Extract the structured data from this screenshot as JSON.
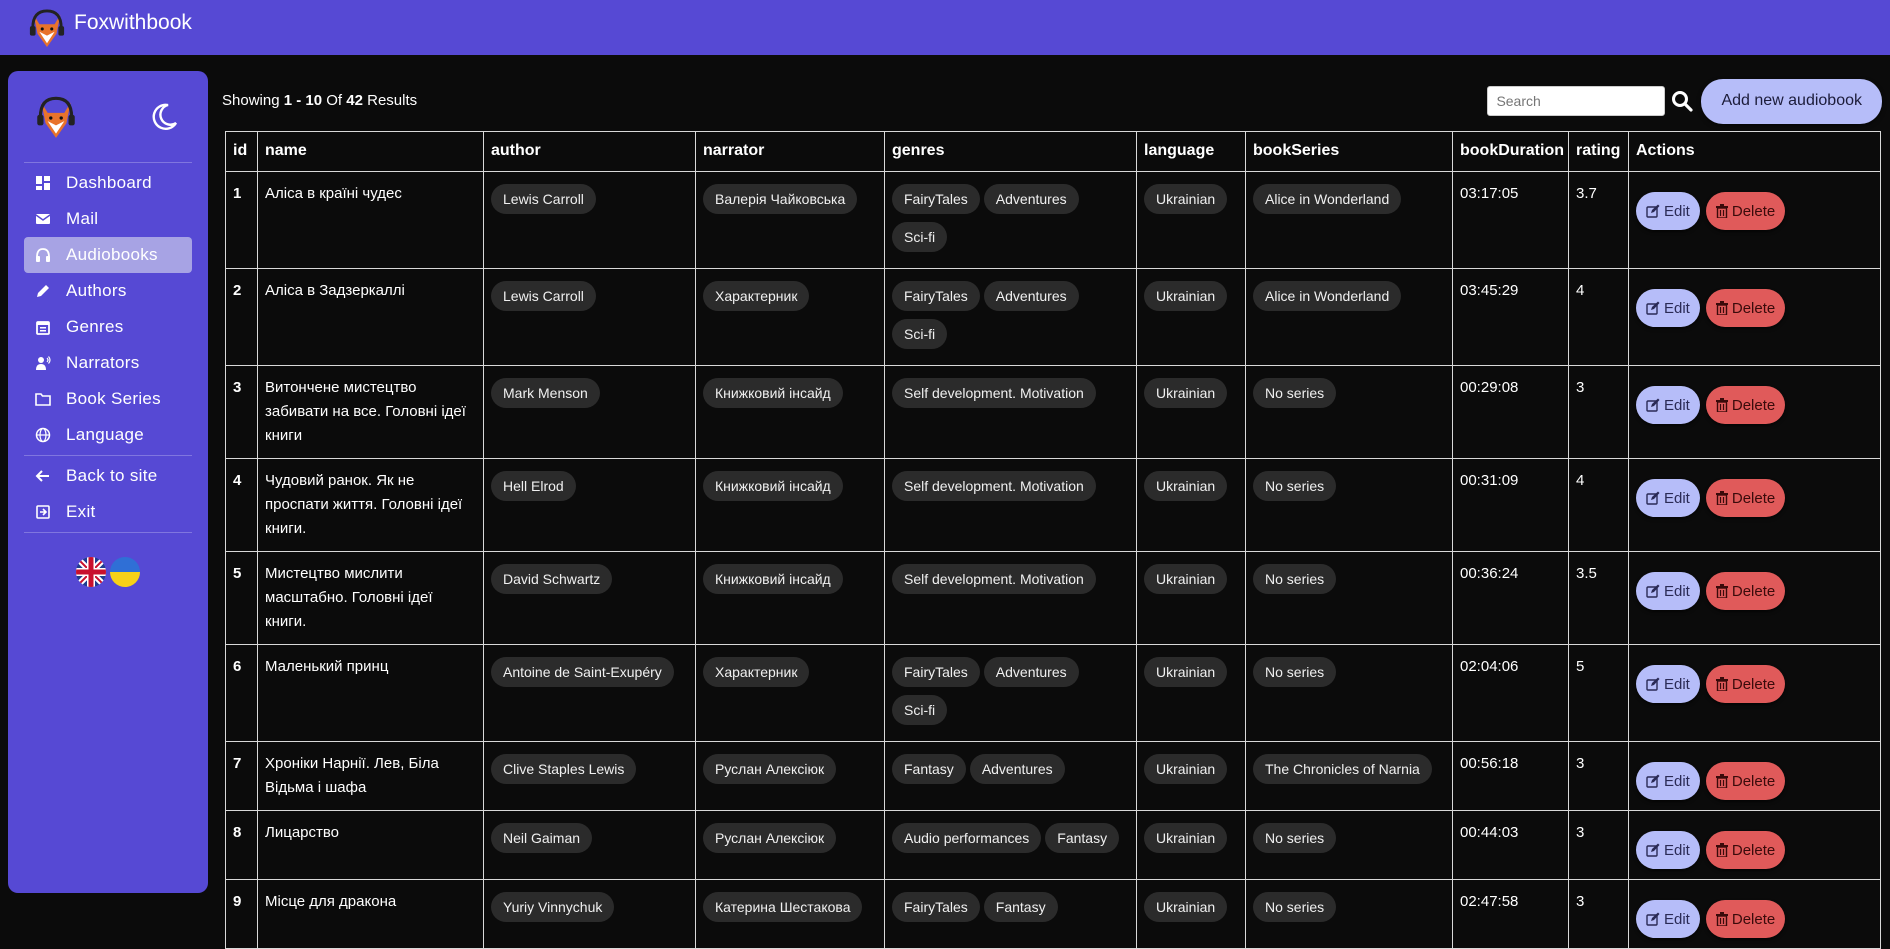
{
  "brand": "Foxwithbook",
  "sidebar": {
    "items": [
      {
        "label": "Dashboard",
        "icon": "dashboard-icon"
      },
      {
        "label": "Mail",
        "icon": "mail-icon"
      },
      {
        "label": "Audiobooks",
        "icon": "headphones-icon",
        "active": true
      },
      {
        "label": "Authors",
        "icon": "pen-icon"
      },
      {
        "label": "Genres",
        "icon": "calendar-icon"
      },
      {
        "label": "Narrators",
        "icon": "person-voice-icon"
      },
      {
        "label": "Book Series",
        "icon": "folder-icon"
      },
      {
        "label": "Language",
        "icon": "globe-icon"
      }
    ],
    "footer_items": [
      {
        "label": "Back to site",
        "icon": "arrow-left-icon"
      },
      {
        "label": "Exit",
        "icon": "exit-icon"
      }
    ]
  },
  "toolbar": {
    "showing_prefix": "Showing ",
    "range": "1 - 10",
    "of_word": " Of ",
    "total": "42",
    "results_word": " Results",
    "search_placeholder": "Search",
    "add_button": "Add new audiobook"
  },
  "table": {
    "headers": [
      "id",
      "name",
      "author",
      "narrator",
      "genres",
      "language",
      "bookSeries",
      "bookDuration",
      "rating",
      "Actions"
    ],
    "edit_label": "Edit",
    "delete_label": "Delete",
    "rows": [
      {
        "id": "1",
        "name": "Аліса в країні чудес",
        "author": "Lewis Carroll",
        "narrator": "Валерія Чайковська",
        "genres": [
          "FairyTales",
          "Adventures",
          "Sci-fi"
        ],
        "language": "Ukrainian",
        "series": "Alice in Wonderland",
        "duration": "03:17:05",
        "rating": "3.7"
      },
      {
        "id": "2",
        "name": "Аліса в Задзеркаллі",
        "author": "Lewis Carroll",
        "narrator": "Характерник",
        "genres": [
          "FairyTales",
          "Adventures",
          "Sci-fi"
        ],
        "language": "Ukrainian",
        "series": "Alice in Wonderland",
        "duration": "03:45:29",
        "rating": "4"
      },
      {
        "id": "3",
        "name": "Витончене мистецтво забивати на все. Головні ідеї книги",
        "author": "Mark Menson",
        "narrator": "Книжковий інсайд",
        "genres": [
          "Self development. Motivation"
        ],
        "language": "Ukrainian",
        "series": "No series",
        "duration": "00:29:08",
        "rating": "3"
      },
      {
        "id": "4",
        "name": "Чудовий ранок. Як не проспати життя. Головні ідеї книги.",
        "author": "Hell Elrod",
        "narrator": "Книжковий інсайд",
        "genres": [
          "Self development. Motivation"
        ],
        "language": "Ukrainian",
        "series": "No series",
        "duration": "00:31:09",
        "rating": "4"
      },
      {
        "id": "5",
        "name": "Мистецтво мислити масштабно. Головні ідеї книги.",
        "author": "David Schwartz",
        "narrator": "Книжковий інсайд",
        "genres": [
          "Self development. Motivation"
        ],
        "language": "Ukrainian",
        "series": "No series",
        "duration": "00:36:24",
        "rating": "3.5"
      },
      {
        "id": "6",
        "name": "Маленький принц",
        "author": "Antoine de Saint-Exupéry",
        "narrator": "Характерник",
        "genres": [
          "FairyTales",
          "Adventures",
          "Sci-fi"
        ],
        "language": "Ukrainian",
        "series": "No series",
        "duration": "02:04:06",
        "rating": "5"
      },
      {
        "id": "7",
        "name": "Хроніки Нарнії. Лев, Біла Відьма і шафа",
        "author": "Clive Staples Lewis",
        "narrator": "Руслан Алексіюк",
        "genres": [
          "Fantasy",
          "Adventures"
        ],
        "language": "Ukrainian",
        "series": "The Chronicles of Narnia",
        "duration": "00:56:18",
        "rating": "3"
      },
      {
        "id": "8",
        "name": "Лицарство",
        "author": "Neil Gaiman",
        "narrator": "Руслан Алексіюк",
        "genres": [
          "Audio performances",
          "Fantasy"
        ],
        "language": "Ukrainian",
        "series": "No series",
        "duration": "00:44:03",
        "rating": "3"
      },
      {
        "id": "9",
        "name": "Місце для дракона",
        "author": "Yuriy Vinnychuk",
        "narrator": "Катерина Шестакова",
        "genres": [
          "FairyTales",
          "Fantasy"
        ],
        "language": "Ukrainian",
        "series": "No series",
        "duration": "02:47:58",
        "rating": "3"
      }
    ]
  }
}
